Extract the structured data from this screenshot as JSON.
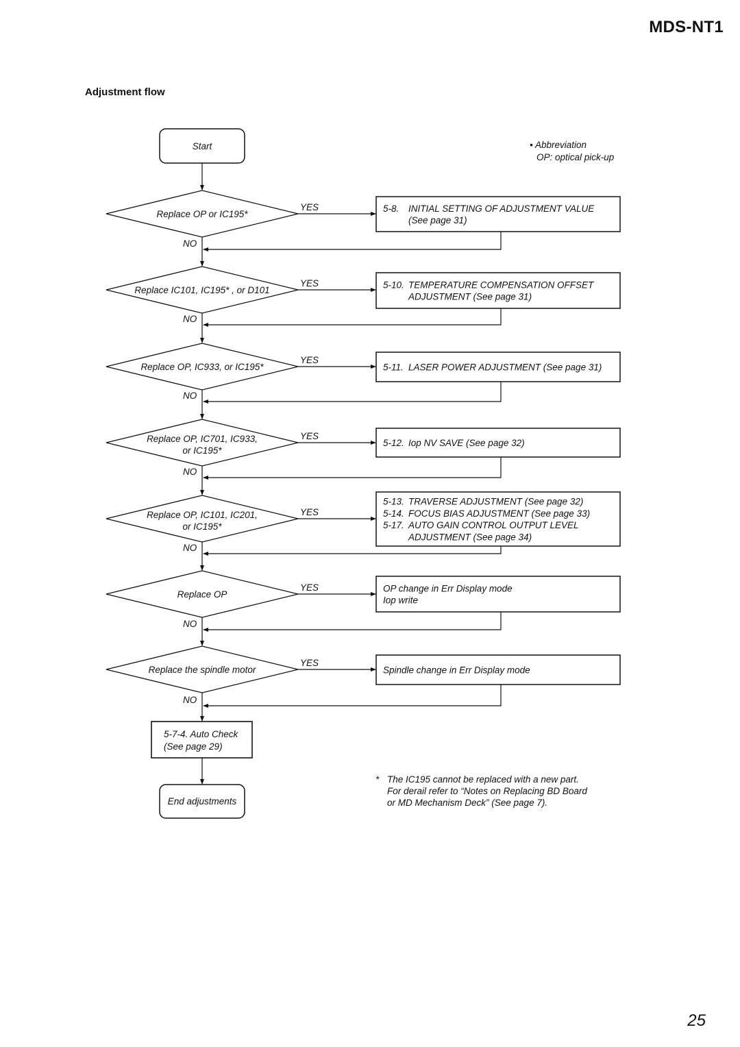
{
  "header": {
    "model": "MDS-NT1",
    "section_title": "Adjustment flow"
  },
  "abbreviation": {
    "title": "Abbreviation",
    "text": "OP: optical pick-up"
  },
  "flow": {
    "start": "Start",
    "yes_label": "YES",
    "no_label": "NO",
    "steps": [
      {
        "decision": [
          "Replace OP or IC195*"
        ],
        "action": [
          [
            "5-8.",
            "INITIAL SETTING OF ADJUSTMENT VALUE"
          ],
          [
            "",
            "(See page 31)"
          ]
        ]
      },
      {
        "decision": [
          "Replace IC101, IC195* , or D101"
        ],
        "action": [
          [
            "5-10.",
            "TEMPERATURE COMPENSATION OFFSET"
          ],
          [
            "",
            "ADJUSTMENT (See page 31)"
          ]
        ]
      },
      {
        "decision": [
          "Replace OP, IC933, or IC195*"
        ],
        "action": [
          [
            "5-11.",
            "LASER POWER ADJUSTMENT (See page 31)"
          ]
        ]
      },
      {
        "decision": [
          "Replace OP, IC701, IC933,",
          "or IC195*"
        ],
        "action": [
          [
            "5-12.",
            "Iop NV SAVE (See page 32)"
          ]
        ]
      },
      {
        "decision": [
          "Replace OP, IC101, IC201,",
          "or IC195*"
        ],
        "action": [
          [
            "5-13.",
            "TRAVERSE ADJUSTMENT (See page 32)"
          ],
          [
            "5-14.",
            "FOCUS BIAS ADJUSTMENT (See page 33)"
          ],
          [
            "5-17.",
            "AUTO GAIN CONTROL OUTPUT LEVEL"
          ],
          [
            "",
            "ADJUSTMENT (See page 34)"
          ]
        ]
      },
      {
        "decision": [
          "Replace OP"
        ],
        "action": [
          [
            "",
            "OP change in Err Display mode"
          ],
          [
            "",
            "Iop write"
          ]
        ]
      },
      {
        "decision": [
          "Replace the spindle motor"
        ],
        "action": [
          [
            "",
            "Spindle change in Err Display mode"
          ]
        ]
      }
    ],
    "auto_check": [
      "5-7-4. Auto Check",
      "(See page 29)"
    ],
    "end": "End adjustments"
  },
  "footnote": {
    "mark": "*",
    "lines": [
      "The IC195 cannot be replaced with a new part.",
      "For derail refer to “Notes on Replacing BD Board",
      "or MD Mechanism Deck” (See page 7)."
    ]
  },
  "page_number": "25"
}
